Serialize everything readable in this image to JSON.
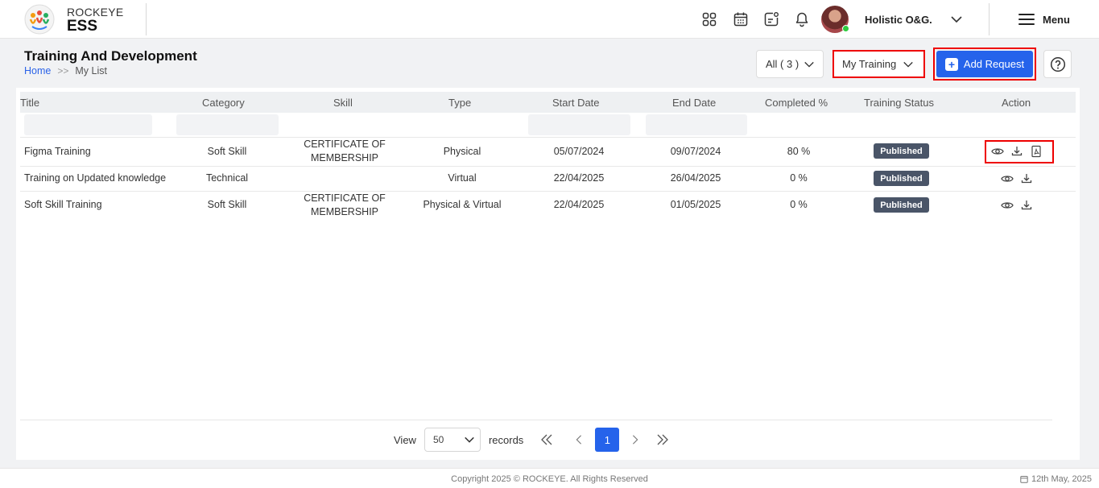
{
  "header": {
    "brand_top": "ROCKEYE",
    "brand_bottom": "ESS",
    "icons": [
      "apps-grid-icon",
      "calendar-icon",
      "chat-notification-icon",
      "bell-icon"
    ],
    "org_name": "Holistic O&G.",
    "menu_label": "Menu"
  },
  "page": {
    "title": "Training And Development",
    "breadcrumb": {
      "home": "Home",
      "separator": ">>",
      "current": "My List"
    }
  },
  "controls": {
    "all_filter": "All ( 3 )",
    "view_select": "My Training",
    "add_button": "Add Request"
  },
  "table": {
    "columns": [
      "Title",
      "Category",
      "Skill",
      "Type",
      "Start Date",
      "End Date",
      "Completed %",
      "Training Status",
      "Action"
    ],
    "rows": [
      {
        "title": "Figma Training",
        "category": "Soft Skill",
        "skill_line1": "CERTIFICATE OF",
        "skill_line2": "MEMBERSHIP",
        "type": "Physical",
        "start": "05/07/2024",
        "end": "09/07/2024",
        "completed": "80 %",
        "status": "Published",
        "actions": [
          "eye-icon",
          "download-icon",
          "pdf-icon"
        ]
      },
      {
        "title": "Training on Updated knowledge",
        "category": "Technical",
        "skill_line1": "",
        "skill_line2": "",
        "type": "Virtual",
        "start": "22/04/2025",
        "end": "26/04/2025",
        "completed": "0 %",
        "status": "Published",
        "actions": [
          "eye-icon",
          "download-icon"
        ]
      },
      {
        "title": "Soft Skill Training",
        "category": "Soft Skill",
        "skill_line1": "CERTIFICATE OF",
        "skill_line2": "MEMBERSHIP",
        "type": "Physical & Virtual",
        "start": "22/04/2025",
        "end": "01/05/2025",
        "completed": "0 %",
        "status": "Published",
        "actions": [
          "eye-icon",
          "download-icon"
        ]
      }
    ]
  },
  "pagination": {
    "view_label": "View",
    "page_size": "50",
    "records_label": "records",
    "current_page": "1"
  },
  "footer": {
    "copyright": "Copyright 2025 © ROCKEYE. All Rights Reserved",
    "date": "12th May, 2025"
  },
  "colors": {
    "accent": "#2563eb",
    "badge": "#4a5568",
    "highlight": "#e00000"
  }
}
